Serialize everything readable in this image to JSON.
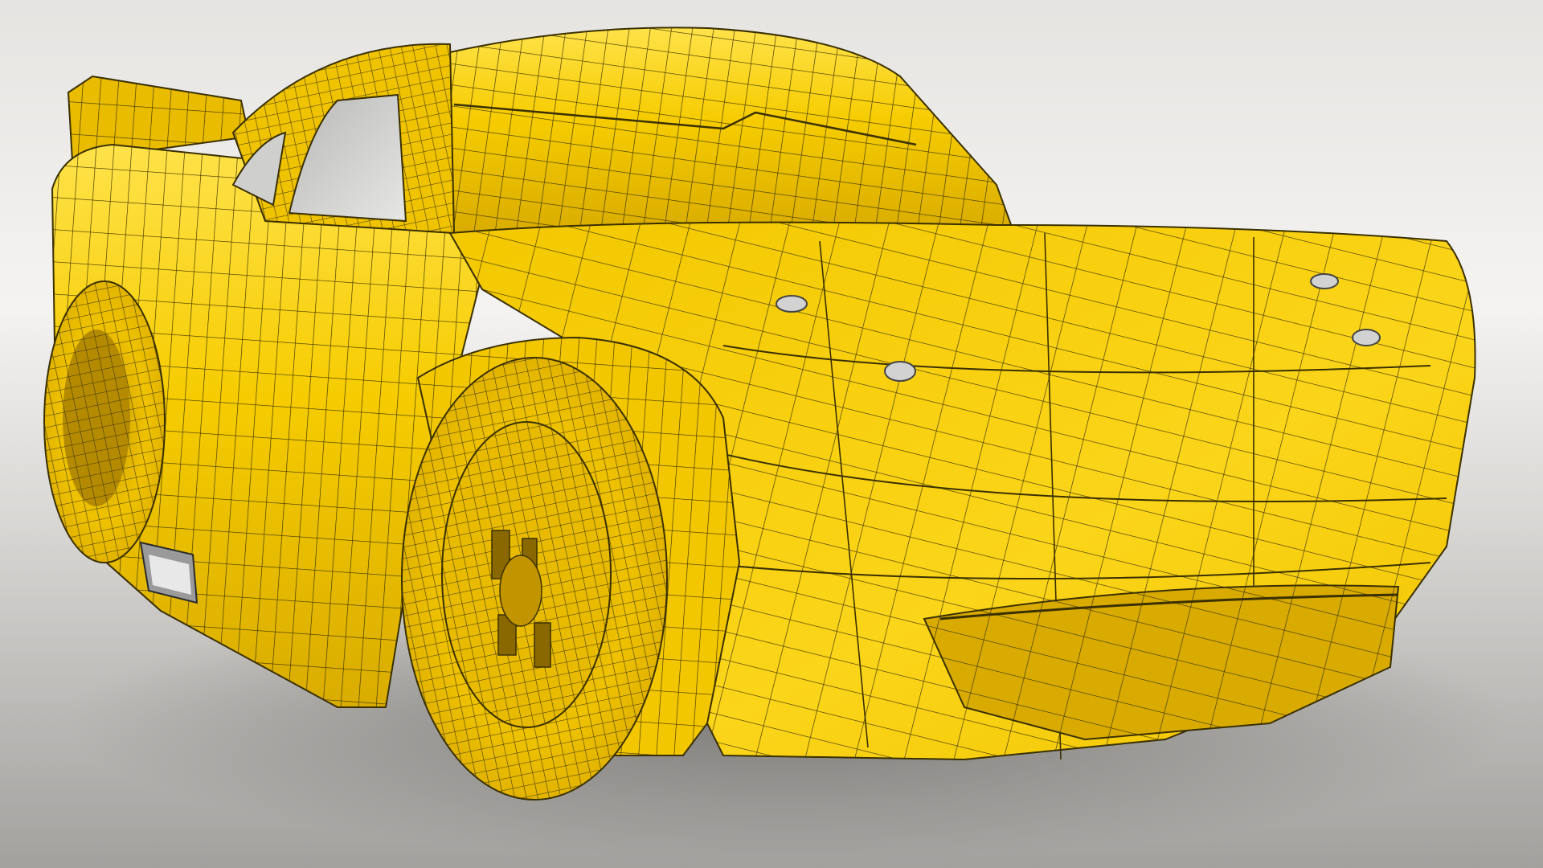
{
  "scene": {
    "subject": "car-wireframe-render",
    "colors": {
      "body_yellow": "#f6cc00",
      "body_shadow": "#c99d00",
      "body_highlight": "#ffe55a",
      "wire": "#3a3000",
      "backdrop_light": "#f2f1ef",
      "backdrop_dark": "#a9a7a4",
      "glass": "#d7d7d5",
      "metal": "#d9d9d9"
    }
  }
}
